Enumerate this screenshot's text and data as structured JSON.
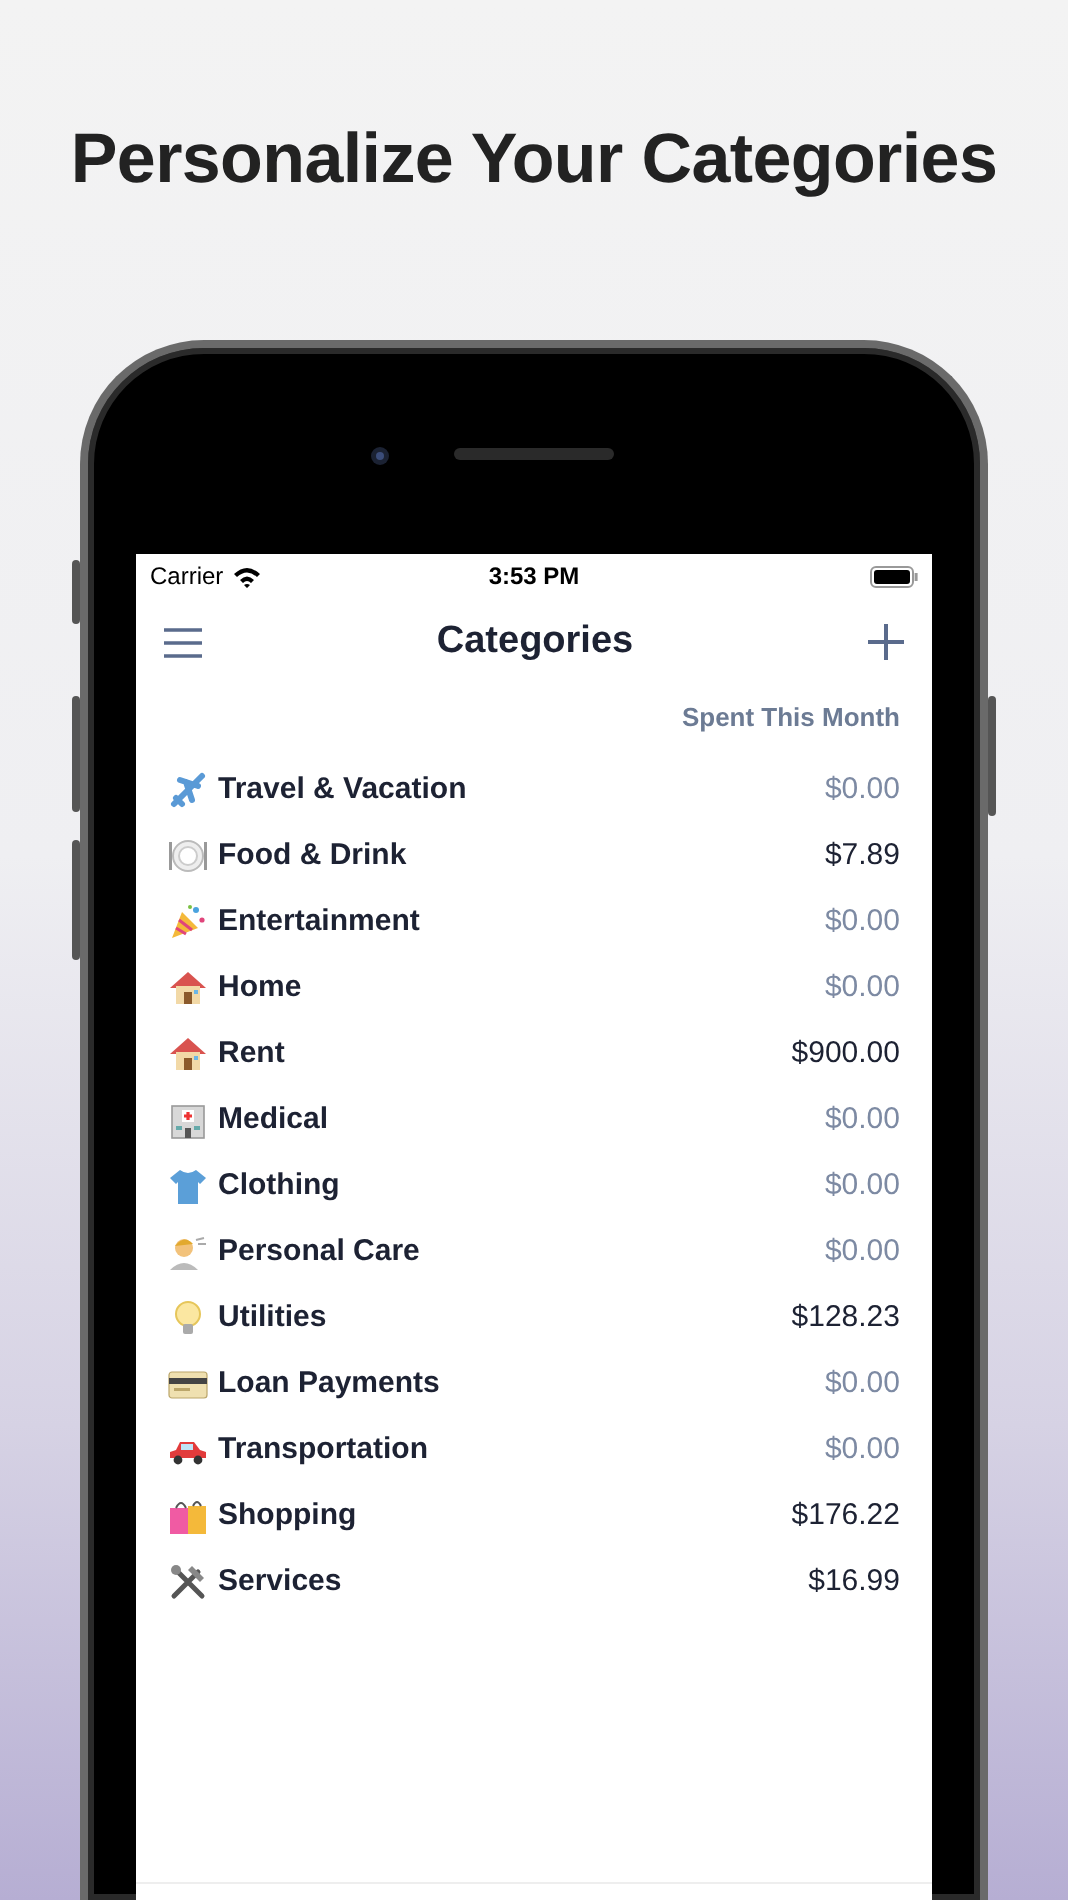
{
  "headline": "Personalize Your Categories",
  "status_bar": {
    "carrier": "Carrier",
    "time": "3:53 PM"
  },
  "nav_bar": {
    "title": "Categories"
  },
  "column_header": "Spent This Month",
  "categories": [
    {
      "kind": "airplane",
      "name": "Travel & Vacation",
      "amount": "$0.00",
      "muted": true
    },
    {
      "kind": "plate",
      "name": "Food & Drink",
      "amount": "$7.89",
      "muted": false
    },
    {
      "kind": "party",
      "name": "Entertainment",
      "amount": "$0.00",
      "muted": true
    },
    {
      "kind": "house",
      "name": "Home",
      "amount": "$0.00",
      "muted": true
    },
    {
      "kind": "house",
      "name": "Rent",
      "amount": "$900.00",
      "muted": false
    },
    {
      "kind": "hospital",
      "name": "Medical",
      "amount": "$0.00",
      "muted": true
    },
    {
      "kind": "shirt",
      "name": "Clothing",
      "amount": "$0.00",
      "muted": true
    },
    {
      "kind": "person",
      "name": "Personal Care",
      "amount": "$0.00",
      "muted": true
    },
    {
      "kind": "bulb",
      "name": "Utilities",
      "amount": "$128.23",
      "muted": false
    },
    {
      "kind": "card",
      "name": "Loan Payments",
      "amount": "$0.00",
      "muted": true
    },
    {
      "kind": "car",
      "name": "Transportation",
      "amount": "$0.00",
      "muted": true
    },
    {
      "kind": "bags",
      "name": "Shopping",
      "amount": "$176.22",
      "muted": false
    },
    {
      "kind": "tools",
      "name": "Services",
      "amount": "$16.99",
      "muted": false
    }
  ]
}
